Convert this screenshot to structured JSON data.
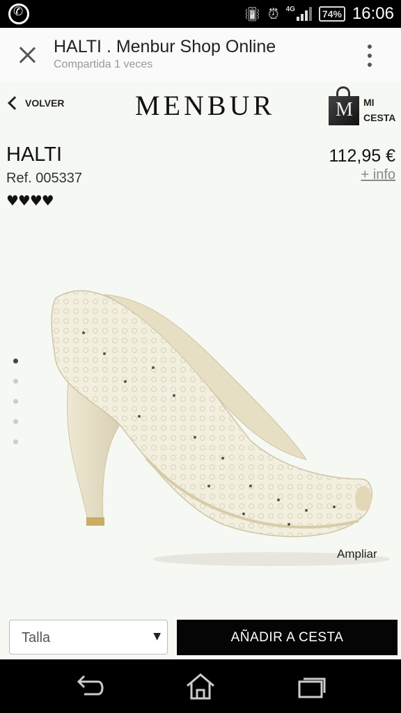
{
  "status_bar": {
    "network": "4G",
    "battery": "74%",
    "time": "16:06",
    "icons": [
      "whatsapp-icon",
      "vibrate-icon",
      "alarm-icon",
      "signal-icon",
      "battery-icon"
    ]
  },
  "app_bar": {
    "title": "HALTI . Menbur Shop Online",
    "subtitle": "Compartida 1 veces",
    "icons": [
      "close-icon",
      "more-vert-icon"
    ]
  },
  "shop_header": {
    "back_label": "VOLVER",
    "brand": "MENBUR",
    "cart_label": "MI CESTA",
    "bag_letter": "M"
  },
  "product": {
    "name": "HALTI",
    "ref": "Ref. 005337",
    "rating_hearts": "♥♥♥♥",
    "rating": 4,
    "price": "112,95 €",
    "info_link": "+ info",
    "zoom_link": "Ampliar",
    "gallery_images": 5,
    "gallery_active": 1
  },
  "purchase": {
    "size_select": "Talla",
    "add_to_cart": "AÑADIR A CESTA"
  },
  "nav_bar": {
    "icons": [
      "back-icon",
      "home-icon",
      "recents-icon"
    ]
  },
  "colors": {
    "page_bg": "#f6f8f3",
    "button_bg": "#050505",
    "shoe_ivory": "#f3efdf"
  }
}
